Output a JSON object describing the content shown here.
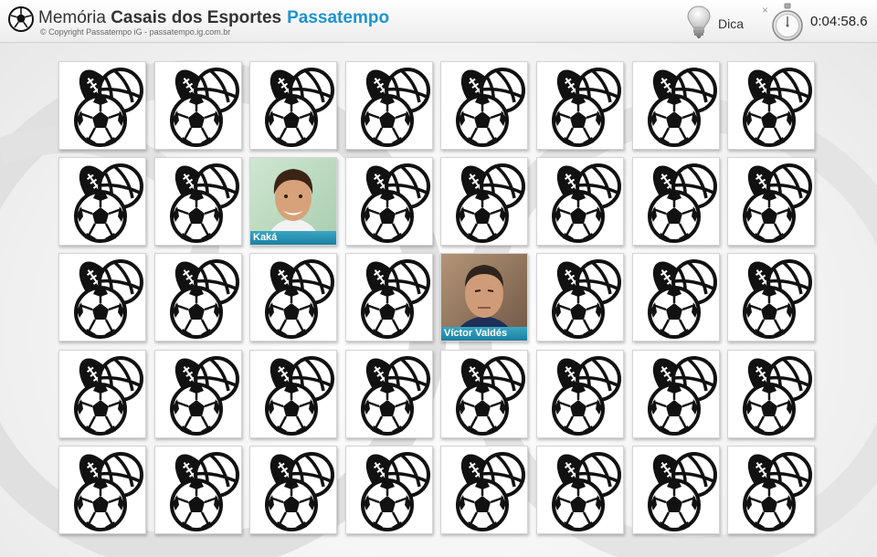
{
  "header": {
    "title_prefix": "Memória",
    "title_main": "Casais dos Esportes",
    "brand": "Passatempo",
    "copyright": "© Copyright Passatempo iG - passatempo.ig.com.br",
    "logo_icon": "soccer-ball-icon",
    "hint_icon": "light-bulb-icon",
    "hint_label": "Dica",
    "close_icon": "close-icon",
    "stopwatch_icon": "stopwatch-icon",
    "timer": "0:04:58.6",
    "brand_color": "#1c94d2"
  },
  "board": {
    "rows": 5,
    "columns": 8,
    "card_back_icon": "sports-balls-icon",
    "revealed_cards": [
      {
        "row": 2,
        "column": 3,
        "name": "Kaká"
      },
      {
        "row": 3,
        "column": 5,
        "name": "Víctor Valdés"
      }
    ]
  }
}
